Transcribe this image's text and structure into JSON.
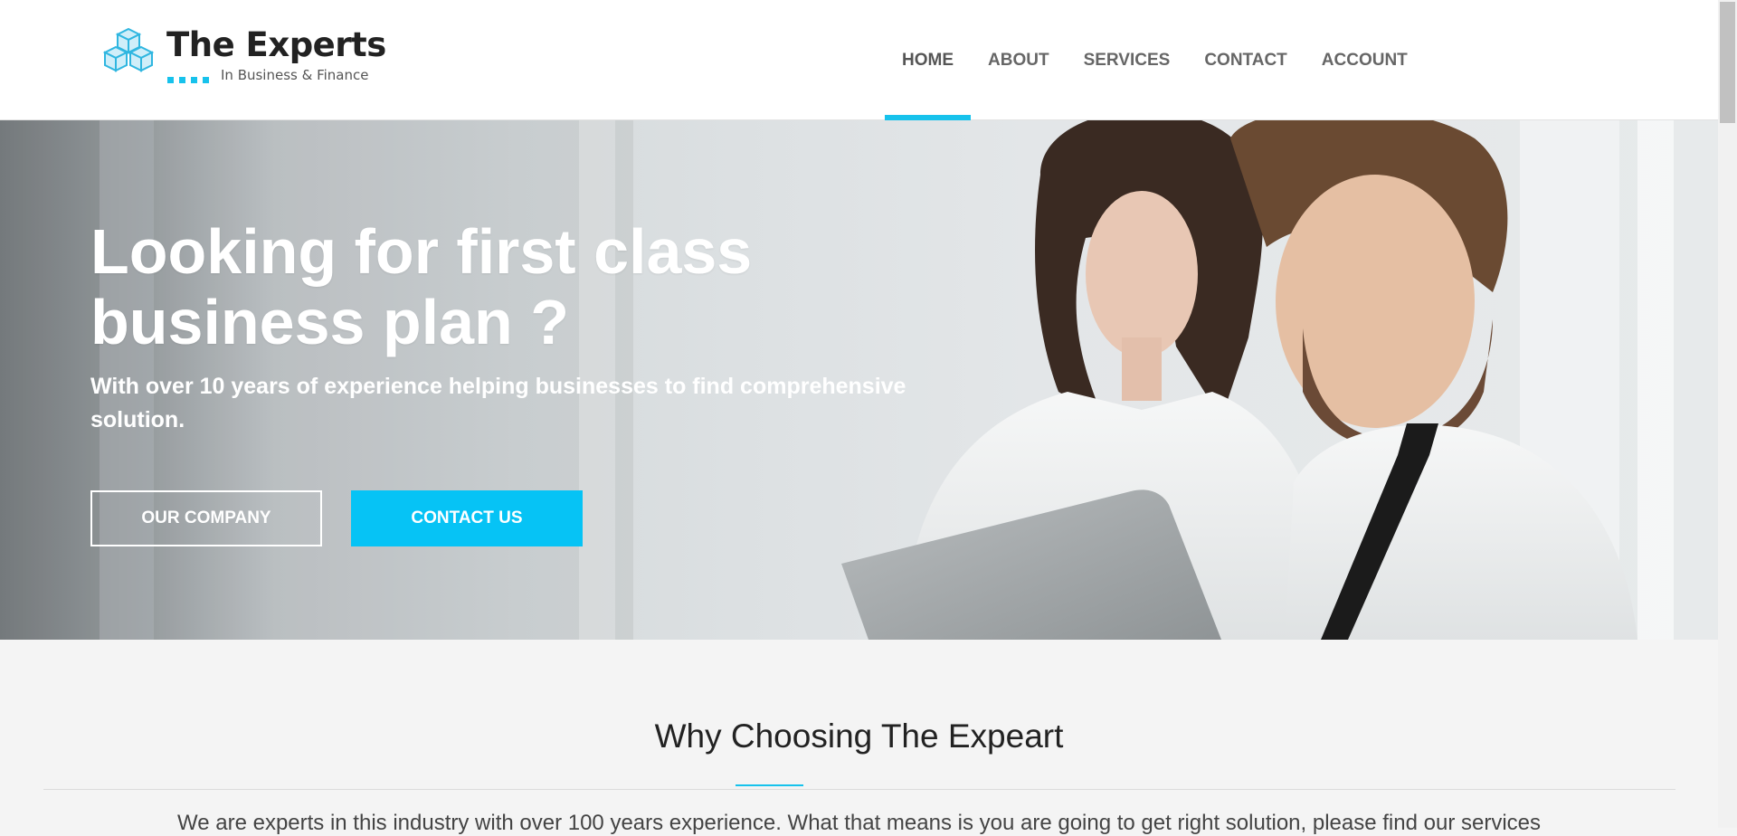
{
  "brand": {
    "name": "The Experts",
    "tagline": "In Business & Finance",
    "accent_color": "#17c2ec",
    "logo_icon": "cubes-icon"
  },
  "nav": {
    "items": [
      {
        "label": "HOME",
        "active": true
      },
      {
        "label": "ABOUT",
        "active": false
      },
      {
        "label": "SERVICES",
        "active": false
      },
      {
        "label": "CONTACT",
        "active": false
      },
      {
        "label": "ACCOUNT",
        "active": false
      }
    ]
  },
  "hero": {
    "title_line1": "Looking for first class",
    "title_line2": "business plan ?",
    "subtitle": "With over 10 years of experience helping businesses to find comprehensive solution.",
    "buttons": {
      "our_company": "OUR COMPANY",
      "contact_us": "CONTACT US"
    },
    "button_color": "#06c3f5"
  },
  "section": {
    "title": "Why Choosing The Expeart",
    "text": "We are experts in this industry with over 100 years experience. What that means is you are going to get right solution, please find our services"
  }
}
